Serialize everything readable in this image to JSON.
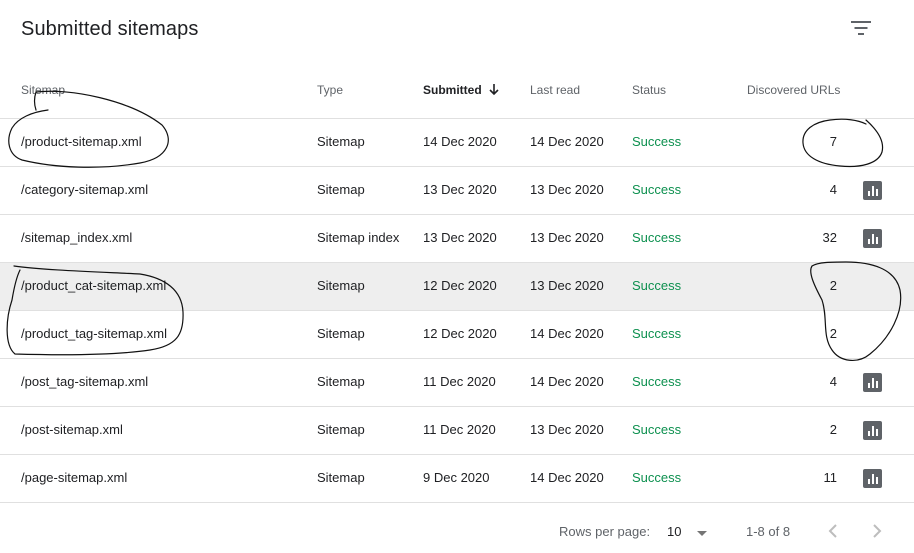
{
  "header": {
    "title": "Submitted sitemaps",
    "filter_icon": "filter-icon"
  },
  "columns": {
    "sitemap": "Sitemap",
    "type": "Type",
    "submitted": "Submitted",
    "last_read": "Last read",
    "status": "Status",
    "discovered": "Discovered URLs"
  },
  "rows": [
    {
      "sitemap": "/product-sitemap.xml",
      "type": "Sitemap",
      "submitted": "14 Dec 2020",
      "last_read": "14 Dec 2020",
      "status": "Success",
      "discovered": "7",
      "chart": false,
      "highlight": false
    },
    {
      "sitemap": "/category-sitemap.xml",
      "type": "Sitemap",
      "submitted": "13 Dec 2020",
      "last_read": "13 Dec 2020",
      "status": "Success",
      "discovered": "4",
      "chart": true,
      "highlight": false
    },
    {
      "sitemap": "/sitemap_index.xml",
      "type": "Sitemap index",
      "submitted": "13 Dec 2020",
      "last_read": "13 Dec 2020",
      "status": "Success",
      "discovered": "32",
      "chart": true,
      "highlight": false
    },
    {
      "sitemap": "/product_cat-sitemap.xml",
      "type": "Sitemap",
      "submitted": "12 Dec 2020",
      "last_read": "13 Dec 2020",
      "status": "Success",
      "discovered": "2",
      "chart": false,
      "highlight": true
    },
    {
      "sitemap": "/product_tag-sitemap.xml",
      "type": "Sitemap",
      "submitted": "12 Dec 2020",
      "last_read": "14 Dec 2020",
      "status": "Success",
      "discovered": "2",
      "chart": false,
      "highlight": false
    },
    {
      "sitemap": "/post_tag-sitemap.xml",
      "type": "Sitemap",
      "submitted": "11 Dec 2020",
      "last_read": "14 Dec 2020",
      "status": "Success",
      "discovered": "4",
      "chart": true,
      "highlight": false
    },
    {
      "sitemap": "/post-sitemap.xml",
      "type": "Sitemap",
      "submitted": "11 Dec 2020",
      "last_read": "13 Dec 2020",
      "status": "Success",
      "discovered": "2",
      "chart": true,
      "highlight": false
    },
    {
      "sitemap": "/page-sitemap.xml",
      "type": "Sitemap",
      "submitted": "9 Dec 2020",
      "last_read": "14 Dec 2020",
      "status": "Success",
      "discovered": "11",
      "chart": true,
      "highlight": false
    }
  ],
  "footer": {
    "rows_per_page_label": "Rows per page:",
    "rows_per_page_value": "10",
    "range": "1-8 of 8"
  },
  "colors": {
    "success": "#0d904f",
    "icon": "#5f6368",
    "highlight_row": "#eeeeee"
  }
}
